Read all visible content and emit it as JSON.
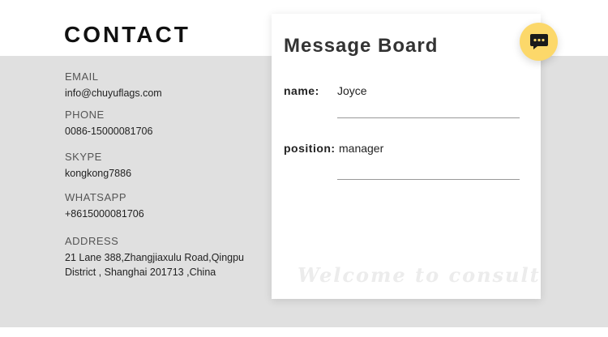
{
  "contact": {
    "title": "CONTACT",
    "items": [
      {
        "label": "EMAIL",
        "value": "info@chuyuflags.com"
      },
      {
        "label": "PHONE",
        "value": "0086-15000081706"
      },
      {
        "label": "SKYPE",
        "value": "kongkong7886"
      },
      {
        "label": "WHATSAPP",
        "value": "+8615000081706"
      },
      {
        "label": "ADDRESS",
        "value_line1": "21 Lane 388,Zhangjiaxulu Road,Qingpu",
        "value_line2": "District , Shanghai 201713 ,China"
      }
    ]
  },
  "message_board": {
    "title": "Message Board",
    "fields": [
      {
        "label": "name:",
        "value": "Joyce"
      },
      {
        "label": "position:",
        "value": "manager"
      }
    ],
    "watermark": "Welcome to consult"
  },
  "chat_button": {
    "icon": "chat-bubble-icon",
    "color": "#fcd86a"
  }
}
